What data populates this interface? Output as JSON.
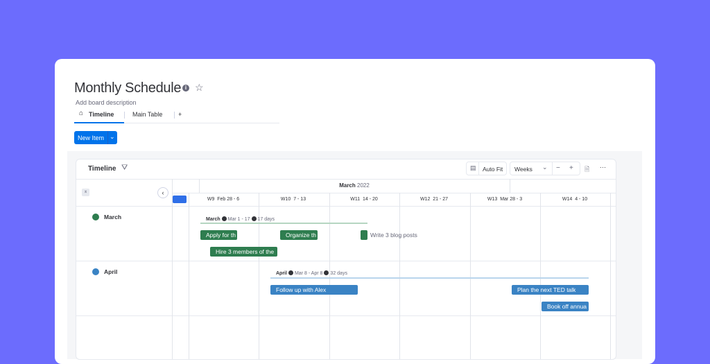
{
  "board": {
    "title": "Monthly Schedule",
    "description": "Add board description",
    "info_icon": "info-icon",
    "star_icon": "star-icon"
  },
  "tabs": [
    {
      "label": "Timeline",
      "icon": "home-icon",
      "active": true
    },
    {
      "label": "Main Table"
    },
    {
      "label": "+"
    }
  ],
  "new_item": {
    "label": "New Item"
  },
  "timeline": {
    "title": "Timeline",
    "toolbar": {
      "auto_fit": "Auto Fit",
      "scale": "Weeks",
      "zoom_out": "−",
      "zoom_in": "+",
      "more": "···"
    },
    "month_header": {
      "month": "March",
      "year": "2022"
    },
    "weeks": [
      {
        "w": "W9",
        "range": "Feb 28 - 6"
      },
      {
        "w": "W10",
        "range": "7 - 13"
      },
      {
        "w": "W11",
        "range": "14 - 20"
      },
      {
        "w": "W12",
        "range": "21 - 27"
      },
      {
        "w": "W13",
        "range": "Mar 28 - 3"
      },
      {
        "w": "W14",
        "range": "4 - 10"
      }
    ],
    "groups": [
      {
        "name": "March",
        "color": "#2e7d4f",
        "summary": {
          "name": "March",
          "range": "Mar 1 - 17",
          "duration": "17 days"
        },
        "items": [
          "Apply for th",
          "Organize th",
          "Write 3 blog posts",
          "Hire 3 members of the"
        ]
      },
      {
        "name": "April",
        "color": "#3a83c4",
        "summary": {
          "name": "April",
          "range": "Mar 8 - Apr 8",
          "duration": "32 days"
        },
        "items": [
          "Follow up with Alex",
          "Plan the next TED talk",
          "Book off annua"
        ]
      }
    ]
  },
  "colors": {
    "background": "#6c6cfd",
    "primary": "#0073ea",
    "green": "#2e7d4f",
    "blue": "#3a83c4"
  }
}
